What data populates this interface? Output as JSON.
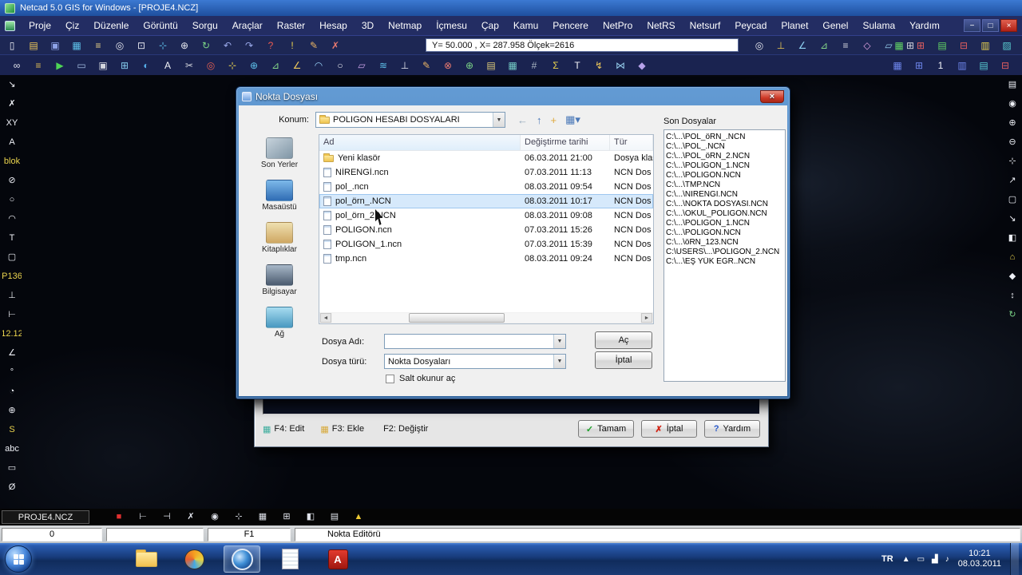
{
  "titlebar": {
    "title": "Netcad 5.0 GIS for Windows - [PROJE4.NCZ]"
  },
  "menubar": {
    "items": [
      "Proje",
      "Çiz",
      "Düzenle",
      "Görüntü",
      "Sorgu",
      "Araçlar",
      "Raster",
      "Hesap",
      "3D",
      "Netmap",
      "İçmesu",
      "Çap",
      "Kamu",
      "Pencere",
      "NetPro",
      "NetRS",
      "Netsurf",
      "Peycad",
      "Planet",
      "Genel",
      "Sulama",
      "Yardım"
    ],
    "window_controls": {
      "minimize": "−",
      "restore": "□",
      "close": "×"
    }
  },
  "toolbar1": {
    "coords": "Y= 50.000 , X= 287.958 Ölçek=2616",
    "left_icons": [
      {
        "name": "new-drawing-icon",
        "glyph": "▯",
        "color": "#eef0f6"
      },
      {
        "name": "open-project-icon",
        "glyph": "▤",
        "color": "#eec85a"
      },
      {
        "name": "save-project-icon",
        "glyph": "▣",
        "color": "#8fa4e8"
      },
      {
        "name": "reference-manager-icon",
        "glyph": "▦",
        "color": "#5ec1ea"
      },
      {
        "name": "layer-list-icon",
        "glyph": "≡",
        "color": "#ead389"
      },
      {
        "name": "zoom-window-icon",
        "glyph": "◎",
        "color": "#e4e6ee"
      },
      {
        "name": "zoom-extents-icon",
        "glyph": "⊡",
        "color": "#e4e6ee"
      },
      {
        "name": "pan-icon",
        "glyph": "⊹",
        "color": "#5ec1ea"
      },
      {
        "name": "move-icon",
        "glyph": "⊕",
        "color": "#e4e6ee"
      },
      {
        "name": "rotate-icon",
        "glyph": "↻",
        "color": "#7bd487"
      },
      {
        "name": "previous-view-icon",
        "glyph": "↶",
        "color": "#9aa9ea"
      },
      {
        "name": "next-view-icon",
        "glyph": "↷",
        "color": "#9aa9ea"
      },
      {
        "name": "help-icon",
        "glyph": "?",
        "color": "#ec5a50"
      },
      {
        "name": "quick-info-icon",
        "glyph": "!",
        "color": "#ecd24e"
      },
      {
        "name": "edit-icon",
        "glyph": "✎",
        "color": "#eab464"
      },
      {
        "name": "delete-icon",
        "glyph": "✗",
        "color": "#ea7a70"
      }
    ],
    "mid_icons": [
      {
        "name": "snap-icon",
        "glyph": "◎",
        "color": "#e4e6ee"
      },
      {
        "name": "ortho-icon",
        "glyph": "⊥",
        "color": "#e8c653"
      },
      {
        "name": "angle-icon",
        "glyph": "∠",
        "color": "#8fd2f2"
      },
      {
        "name": "triangle-icon",
        "glyph": "⊿",
        "color": "#84d688"
      },
      {
        "name": "layers-icon",
        "glyph": "≡",
        "color": "#d4d6de"
      },
      {
        "name": "polygon-icon",
        "glyph": "◇",
        "color": "#e2a4e4"
      },
      {
        "name": "parcel-icon",
        "glyph": "▱",
        "color": "#94cbea"
      },
      {
        "name": "grid-icon",
        "glyph": "⊞",
        "color": "#d4d6de"
      }
    ],
    "right_icons": [
      {
        "name": "table-add-icon",
        "glyph": "▦",
        "color": "#62d565"
      },
      {
        "name": "table-remove-icon",
        "glyph": "⊞",
        "color": "#e55f5f"
      },
      {
        "name": "sheet-add-icon",
        "glyph": "▤",
        "color": "#62d565"
      },
      {
        "name": "sheet-remove-icon",
        "glyph": "⊟",
        "color": "#e55f5f"
      },
      {
        "name": "sheet-edit-icon",
        "glyph": "▥",
        "color": "#ead34e"
      },
      {
        "name": "sheet-view-icon",
        "glyph": "▨",
        "color": "#58cbd0"
      }
    ]
  },
  "toolbar2": {
    "icons": [
      {
        "name": "preview-icon",
        "glyph": "∞",
        "color": "#e4e6ee"
      },
      {
        "name": "list-icon",
        "glyph": "≡",
        "color": "#e0bd55"
      },
      {
        "name": "run-icon",
        "glyph": "▶",
        "color": "#4ed455"
      },
      {
        "name": "monitor-icon",
        "glyph": "▭",
        "color": "#a2bce0"
      },
      {
        "name": "window-icon",
        "glyph": "▣",
        "color": "#d4d6de"
      },
      {
        "name": "tile-windows-icon",
        "glyph": "⊞",
        "color": "#86cdee"
      },
      {
        "name": "globe-icon",
        "glyph": "◐",
        "color": "#54abe6"
      },
      {
        "name": "text-icon",
        "glyph": "A",
        "color": "#f2f3f8"
      },
      {
        "name": "scissors-icon",
        "glyph": "✂",
        "color": "#d4d6de"
      },
      {
        "name": "target-icon",
        "glyph": "◎",
        "color": "#e55f50"
      },
      {
        "name": "cross-icon",
        "glyph": "⊹",
        "color": "#ead34e"
      },
      {
        "name": "move-point-icon",
        "glyph": "⊕",
        "color": "#5ec1ea"
      },
      {
        "name": "slope-icon",
        "glyph": "⊿",
        "color": "#84d688"
      },
      {
        "name": "angle-measure-icon",
        "glyph": "∠",
        "color": "#eec85a"
      },
      {
        "name": "arc-icon",
        "glyph": "◠",
        "color": "#94cbf2"
      },
      {
        "name": "circle-icon",
        "glyph": "○",
        "color": "#e4e6ee"
      },
      {
        "name": "parallelogram-icon",
        "glyph": "▱",
        "color": "#c9a0e8"
      },
      {
        "name": "contour-icon",
        "glyph": "≋",
        "color": "#5ec1ea"
      },
      {
        "name": "perpendicular-icon",
        "glyph": "⊥",
        "color": "#e4e6ee"
      },
      {
        "name": "draw-icon",
        "glyph": "✎",
        "color": "#eab464"
      },
      {
        "name": "delete-node-icon",
        "glyph": "⊗",
        "color": "#ea7a70"
      },
      {
        "name": "add-node-icon",
        "glyph": "⊕",
        "color": "#7bd487"
      },
      {
        "name": "legend-icon",
        "glyph": "▤",
        "color": "#dcc878"
      },
      {
        "name": "raster-grid-icon",
        "glyph": "▦",
        "color": "#74cbc5"
      },
      {
        "name": "hatch-icon",
        "glyph": "#",
        "color": "#aab6c4"
      },
      {
        "name": "sum-icon",
        "glyph": "Σ",
        "color": "#ead34e"
      },
      {
        "name": "label-icon",
        "glyph": "T",
        "color": "#f2f3f8"
      },
      {
        "name": "bolt-icon",
        "glyph": "↯",
        "color": "#eec85a"
      },
      {
        "name": "join-icon",
        "glyph": "⋈",
        "color": "#94cbea"
      },
      {
        "name": "diamond-icon",
        "glyph": "◆",
        "color": "#b7a2ea"
      }
    ],
    "right_icons": [
      {
        "name": "grid-blue-icon",
        "glyph": "▦",
        "color": "#6e86ec"
      },
      {
        "name": "grid-plus-icon",
        "glyph": "⊞",
        "color": "#6e86ec"
      },
      {
        "name": "scale-one-icon",
        "glyph": "1",
        "color": "#f2f3f8"
      },
      {
        "name": "sheet-blue-icon",
        "glyph": "▥",
        "color": "#6e86ec"
      },
      {
        "name": "sheet-teal-icon",
        "glyph": "▤",
        "color": "#58cbd0"
      },
      {
        "name": "sheet-minus-icon",
        "glyph": "⊟",
        "color": "#e55f5f"
      }
    ]
  },
  "left_toolbar": {
    "icons": [
      {
        "name": "select-icon",
        "glyph": "↘",
        "color": "#eef0f6"
      },
      {
        "name": "delete-icon",
        "glyph": "✗",
        "color": "#eef0f6"
      },
      {
        "name": "coordinate-icon",
        "glyph": "XY",
        "color": "#eef0f6"
      },
      {
        "name": "text-icon",
        "glyph": "A",
        "color": "#eef0f6"
      },
      {
        "name": "block-icon",
        "glyph": "blok",
        "color": "#ead34e"
      },
      {
        "name": "no-draw-icon",
        "glyph": "⊘",
        "color": "#eef0f6"
      },
      {
        "name": "circle-icon",
        "glyph": "○",
        "color": "#eef0f6"
      },
      {
        "name": "arc-icon",
        "glyph": "◠",
        "color": "#eef0f6"
      },
      {
        "name": "tangent-icon",
        "glyph": "T",
        "color": "#eef0f6"
      },
      {
        "name": "frame-icon",
        "glyph": "▢",
        "color": "#eef0f6"
      },
      {
        "name": "point-number-icon",
        "glyph": "P136",
        "color": "#ead34e"
      },
      {
        "name": "perpendicular-icon",
        "glyph": "⊥",
        "color": "#eef0f6"
      },
      {
        "name": "ruler-icon",
        "glyph": "⊢",
        "color": "#eef0f6"
      },
      {
        "name": "measure-icon",
        "glyph": "12.12",
        "color": "#ead34e"
      },
      {
        "name": "angle-icon",
        "glyph": "∠",
        "color": "#eef0f6"
      },
      {
        "name": "degree-icon",
        "glyph": "°",
        "color": "#eef0f6"
      },
      {
        "name": "quarter-circle-icon",
        "glyph": "◔",
        "color": "#eef0f6"
      },
      {
        "name": "plus-circle-icon",
        "glyph": "⊕",
        "color": "#eef0f6"
      },
      {
        "name": "spline-icon",
        "glyph": "S",
        "color": "#ead34e"
      },
      {
        "name": "abc-icon",
        "glyph": "abc",
        "color": "#eef0f6"
      },
      {
        "name": "rectangle-icon",
        "glyph": "▭",
        "color": "#eef0f6"
      },
      {
        "name": "diameter-icon",
        "glyph": "Ø",
        "color": "#eef0f6"
      }
    ]
  },
  "right_toolbar": {
    "icons": [
      {
        "name": "layout-icon",
        "glyph": "▤",
        "color": "#eef0f6"
      },
      {
        "name": "focus-icon",
        "glyph": "◉",
        "color": "#eef0f6"
      },
      {
        "name": "zoom-in-icon",
        "glyph": "⊕",
        "color": "#eef0f6"
      },
      {
        "name": "zoom-out-icon",
        "glyph": "⊖",
        "color": "#eef0f6"
      },
      {
        "name": "pan-hand-icon",
        "glyph": "⊹",
        "color": "#eef0f6"
      },
      {
        "name": "extend-icon",
        "glyph": "↗",
        "color": "#eef0f6"
      },
      {
        "name": "page-icon",
        "glyph": "▢",
        "color": "#eef0f6"
      },
      {
        "name": "corner-icon",
        "glyph": "↘",
        "color": "#eef0f6"
      },
      {
        "name": "half-view-icon",
        "glyph": "◧",
        "color": "#eef0f6"
      },
      {
        "name": "home-icon",
        "glyph": "⌂",
        "color": "#ead34e"
      },
      {
        "name": "diamond-icon",
        "glyph": "◆",
        "color": "#eef0f6"
      },
      {
        "name": "updown-icon",
        "glyph": "↕",
        "color": "#eef0f6"
      },
      {
        "name": "refresh-icon",
        "glyph": "↻",
        "color": "#7bd487"
      }
    ]
  },
  "dialog": {
    "title": "Nokta Dosyası",
    "close": "×",
    "location_label": "Konum:",
    "location_value": "POLIGON HESABI DOSYALARI",
    "combo_arrow": "▼",
    "nav_icons": [
      {
        "name": "back-icon",
        "glyph": "←",
        "color": "#93a7bb"
      },
      {
        "name": "up-folder-icon",
        "glyph": "↑",
        "color": "#4a78b8"
      },
      {
        "name": "new-folder-icon",
        "glyph": "+",
        "color": "#dfa93c"
      },
      {
        "name": "views-icon",
        "glyph": "▦▾",
        "color": "#4a78b8"
      }
    ],
    "places": [
      {
        "label": "Son Yerler",
        "icon": "recent",
        "icon_name": "recent-places-icon"
      },
      {
        "label": "Masaüstü",
        "icon": "desktop",
        "icon_name": "desktop-icon"
      },
      {
        "label": "Kitaplıklar",
        "icon": "libraries",
        "icon_name": "libraries-icon"
      },
      {
        "label": "Bilgisayar",
        "icon": "computer",
        "icon_name": "computer-icon"
      },
      {
        "label": "Ağ",
        "icon": "network",
        "icon_name": "network-icon"
      }
    ],
    "list": {
      "columns": [
        "Ad",
        "Değiştirme tarihi",
        "Tür"
      ],
      "files": [
        {
          "name": "Yeni klasör",
          "date": "06.03.2011 21:00",
          "type": "Dosya klas",
          "icon": "folder"
        },
        {
          "name": "NİRENGİ.ncn",
          "date": "07.03.2011 11:13",
          "type": "NCN Dos",
          "icon": "ncn"
        },
        {
          "name": "pol_.ncn",
          "date": "08.03.2011 09:54",
          "type": "NCN Dos",
          "icon": "ncn"
        },
        {
          "name": "pol_örn_.NCN",
          "date": "08.03.2011 10:17",
          "type": "NCN Dos",
          "icon": "ncn",
          "selected": true
        },
        {
          "name": "pol_örn_2.NCN",
          "date": "08.03.2011 09:08",
          "type": "NCN Dos",
          "icon": "ncn"
        },
        {
          "name": "POLIGON.ncn",
          "date": "07.03.2011 15:26",
          "type": "NCN Dos",
          "icon": "ncn"
        },
        {
          "name": "POLIGON_1.ncn",
          "date": "07.03.2011 15:39",
          "type": "NCN Dos",
          "icon": "ncn"
        },
        {
          "name": "tmp.ncn",
          "date": "08.03.2011 09:24",
          "type": "NCN Dos",
          "icon": "ncn"
        }
      ]
    },
    "scroll": {
      "left": "◄",
      "right": "►"
    },
    "recent": {
      "title": "Son Dosyalar",
      "files": [
        "C:\\...\\POL_öRN_.NCN",
        "C:\\...\\POL_.NCN",
        "C:\\...\\POL_öRN_2.NCN",
        "C:\\...\\POLIGON_1.NCN",
        "C:\\...\\POLIGON.NCN",
        "C:\\...\\TMP.NCN",
        "C:\\...\\NİRENGİ.NCN",
        "C:\\...\\NOKTA DOSYASI.NCN",
        "C:\\...\\OKUL_POLIGON.NCN",
        "C:\\...\\POLIGON_1.NCN",
        "C:\\...\\POLIGON.NCN",
        "C:\\...\\öRN_123.NCN",
        "C:\\USERS\\...\\POLIGON_2.NCN",
        "C:\\...\\EŞ YÜK EĞR..NCN"
      ]
    },
    "filename_label": "Dosya Adı:",
    "filename_value": "",
    "filetype_label": "Dosya türü:",
    "filetype_value": "Nokta Dosyaları",
    "readonly_label": "Salt okunur aç",
    "open_label": "Aç",
    "cancel_label": "İptal"
  },
  "editor_dialog": {
    "buttons_left": [
      {
        "label": "F4: Edit",
        "glyph": "▦",
        "color": "#3fae9e"
      },
      {
        "label": "F3: Ekle",
        "glyph": "▦",
        "color": "#d7a93a"
      },
      {
        "label": "F2: Değiştir",
        "glyph": "",
        "color": ""
      }
    ],
    "ok_label": "Tamam",
    "ok_icon": "✓",
    "cancel_label": "İptal",
    "cancel_icon": "✗",
    "help_label": "Yardım",
    "help_icon": "?"
  },
  "statusbar": {
    "project": "PROJE4.NCZ",
    "icons": [
      {
        "name": "record-icon",
        "glyph": "■",
        "color": "#e03030"
      },
      {
        "name": "segment-start-icon",
        "glyph": "⊢",
        "color": "#dfe2ea"
      },
      {
        "name": "segment-end-icon",
        "glyph": "⊣",
        "color": "#dfe2ea"
      },
      {
        "name": "close-node-icon",
        "glyph": "✗",
        "color": "#dfe2ea"
      },
      {
        "name": "circle-node-icon",
        "glyph": "◉",
        "color": "#dfe2ea"
      },
      {
        "name": "cross-node-icon",
        "glyph": "⊹",
        "color": "#dfe2ea"
      },
      {
        "name": "grid-node-icon",
        "glyph": "▦",
        "color": "#dfe2ea"
      },
      {
        "name": "plus-grid-icon",
        "glyph": "⊞",
        "color": "#dfe2ea"
      },
      {
        "name": "half-grid-icon",
        "glyph": "◧",
        "color": "#dfe2ea"
      },
      {
        "name": "sheet-icon",
        "glyph": "▤",
        "color": "#dfe2ea"
      },
      {
        "name": "warning-icon",
        "glyph": "▲",
        "color": "#ecc832"
      }
    ],
    "cells": {
      "c1": "0",
      "c2": "",
      "c3": "F1",
      "mode": "Nokta Editörü"
    }
  },
  "taskbar": {
    "apps": [
      {
        "name": "explorer-icon",
        "kind": "folder",
        "glyph": ""
      },
      {
        "name": "media-player-icon",
        "kind": "media",
        "glyph": ""
      },
      {
        "name": "netcad-taskbar-icon",
        "kind": "netcad",
        "glyph": "",
        "active": true
      },
      {
        "name": "notepad-icon",
        "kind": "notepad",
        "glyph": ""
      },
      {
        "name": "acrobat-icon",
        "kind": "acrobat",
        "glyph": "A"
      }
    ],
    "tray": {
      "lang": "TR",
      "icons": [
        {
          "name": "show-hidden-icons-icon",
          "glyph": "▲"
        },
        {
          "name": "display-tray-icon",
          "glyph": "▭"
        },
        {
          "name": "network-tray-icon",
          "glyph": "▟"
        },
        {
          "name": "volume-icon",
          "glyph": "♪"
        }
      ],
      "time": "10:21",
      "date": "08.03.2011"
    }
  }
}
